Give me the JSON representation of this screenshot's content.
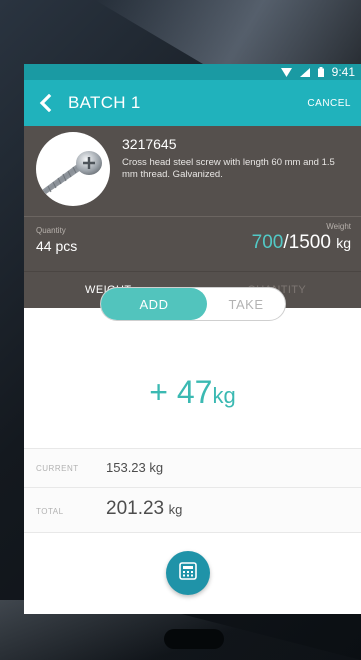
{
  "status_bar": {
    "time": "9:41"
  },
  "app_bar": {
    "title": "BATCH 1",
    "cancel_label": "CANCEL"
  },
  "product": {
    "code": "3217645",
    "description": "Cross head steel screw with length 60 mm and 1.5 mm thread. Galvanized."
  },
  "stats": {
    "quantity_label": "Quantity",
    "quantity_value": "44 pcs",
    "weight_label": "Weight",
    "weight_current": "700",
    "weight_separator": "/",
    "weight_total": "1500",
    "weight_unit": "kg"
  },
  "tabs": [
    {
      "label": "WEIGHT",
      "active": true
    },
    {
      "label": "QUANTITY",
      "active": false
    }
  ],
  "toggle": {
    "add_label": "ADD",
    "take_label": "TAKE",
    "selected": "ADD"
  },
  "delta": {
    "value": "+ 47",
    "unit": "kg"
  },
  "summary": {
    "current_label": "CURRENT",
    "current_value": "153.23 kg",
    "total_label": "TOTAL",
    "total_value": "201.23",
    "total_unit": "kg"
  },
  "icons": {
    "back": "chevron-left-icon",
    "calculator": "calculator-icon",
    "wifi": "wifi-icon",
    "signal": "signal-icon",
    "battery": "battery-icon"
  },
  "colors": {
    "accent": "#20b2bc",
    "status_bar": "#1a9aa3",
    "card_bg": "#55504d",
    "highlight": "#52c4bd",
    "fab": "#1f93a8"
  }
}
